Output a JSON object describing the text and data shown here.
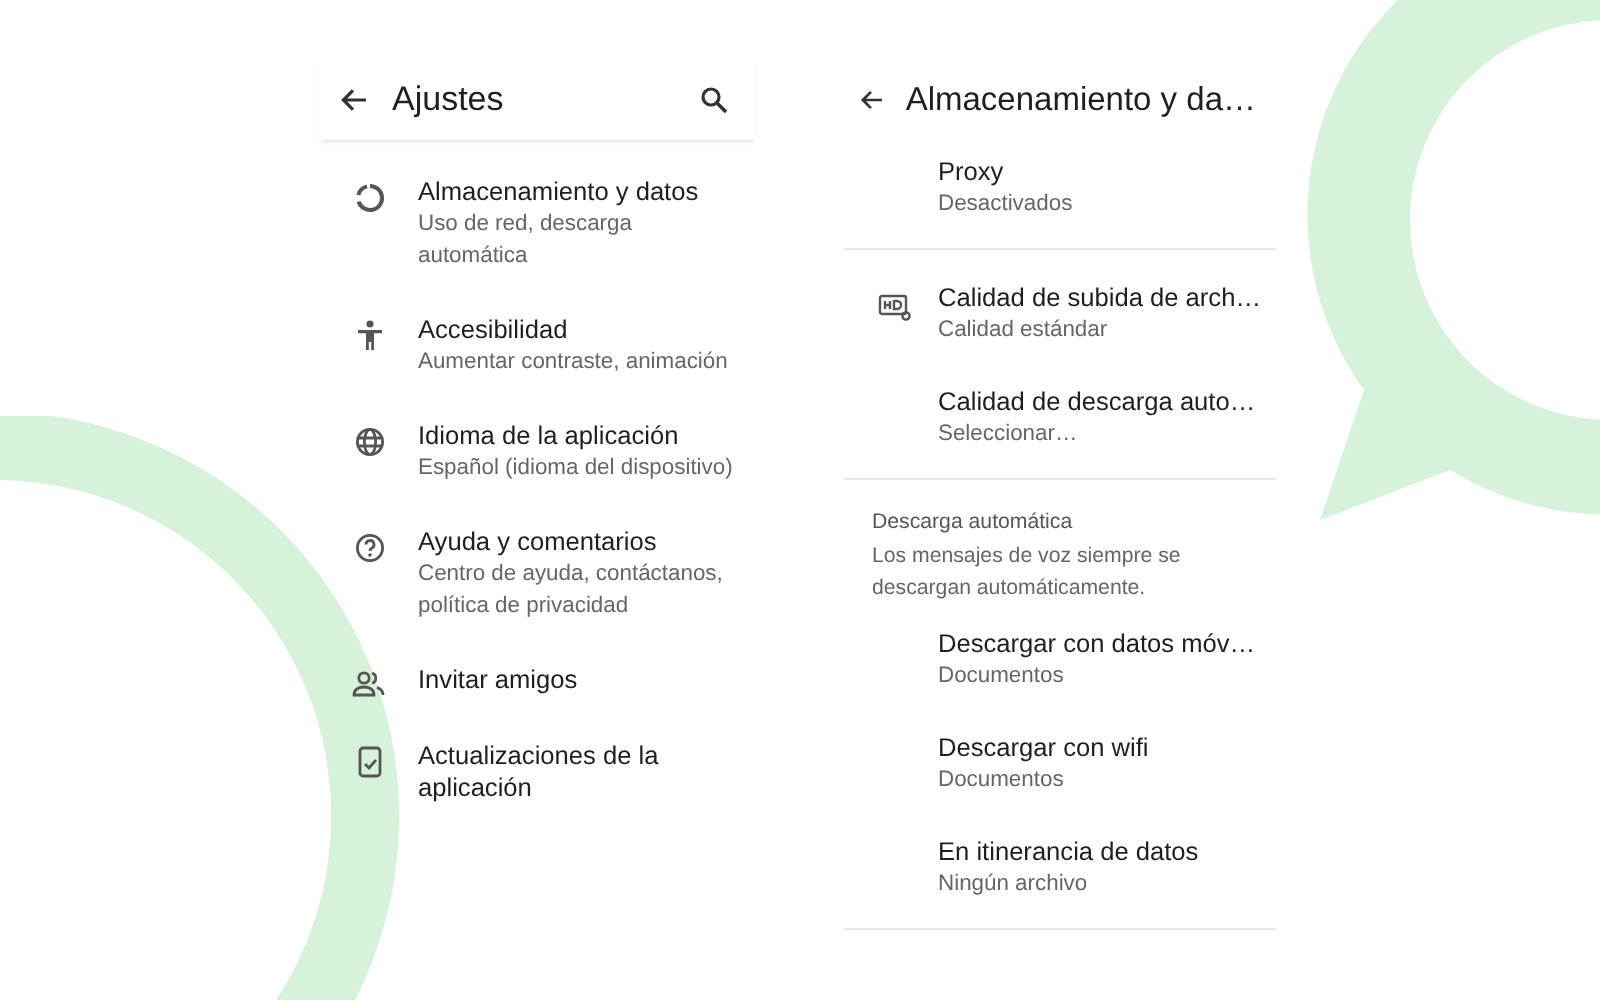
{
  "settings_screen": {
    "title": "Ajustes",
    "items": [
      {
        "title": "Almacenamiento y datos",
        "subtitle": "Uso de red, descarga automática"
      },
      {
        "title": "Accesibilidad",
        "subtitle": "Aumentar contraste, animación"
      },
      {
        "title": "Idioma de la aplicación",
        "subtitle": "Español (idioma del dispositivo)"
      },
      {
        "title": "Ayuda y comentarios",
        "subtitle": "Centro de ayuda, contáctanos, política de privacidad"
      },
      {
        "title": "Invitar amigos"
      },
      {
        "title": "Actualizaciones de la aplicación"
      }
    ]
  },
  "storage_screen": {
    "title": "Almacenamiento y da…",
    "sections": [
      {
        "items": [
          {
            "title": "Proxy",
            "subtitle": "Desactivados"
          }
        ]
      },
      {
        "items": [
          {
            "title": "Calidad de subida de arch…",
            "subtitle": "Calidad estándar"
          },
          {
            "title": "Calidad de descarga auto…",
            "subtitle": "Seleccionar…"
          }
        ]
      },
      {
        "header": "Descarga automática",
        "note": "Los mensajes de voz siempre se descargan automáticamente.",
        "items": [
          {
            "title": "Descargar con datos móv…",
            "subtitle": "Documentos"
          },
          {
            "title": "Descargar con wifi",
            "subtitle": "Documentos"
          },
          {
            "title": "En itinerancia de datos",
            "subtitle": "Ningún archivo"
          }
        ]
      }
    ]
  }
}
